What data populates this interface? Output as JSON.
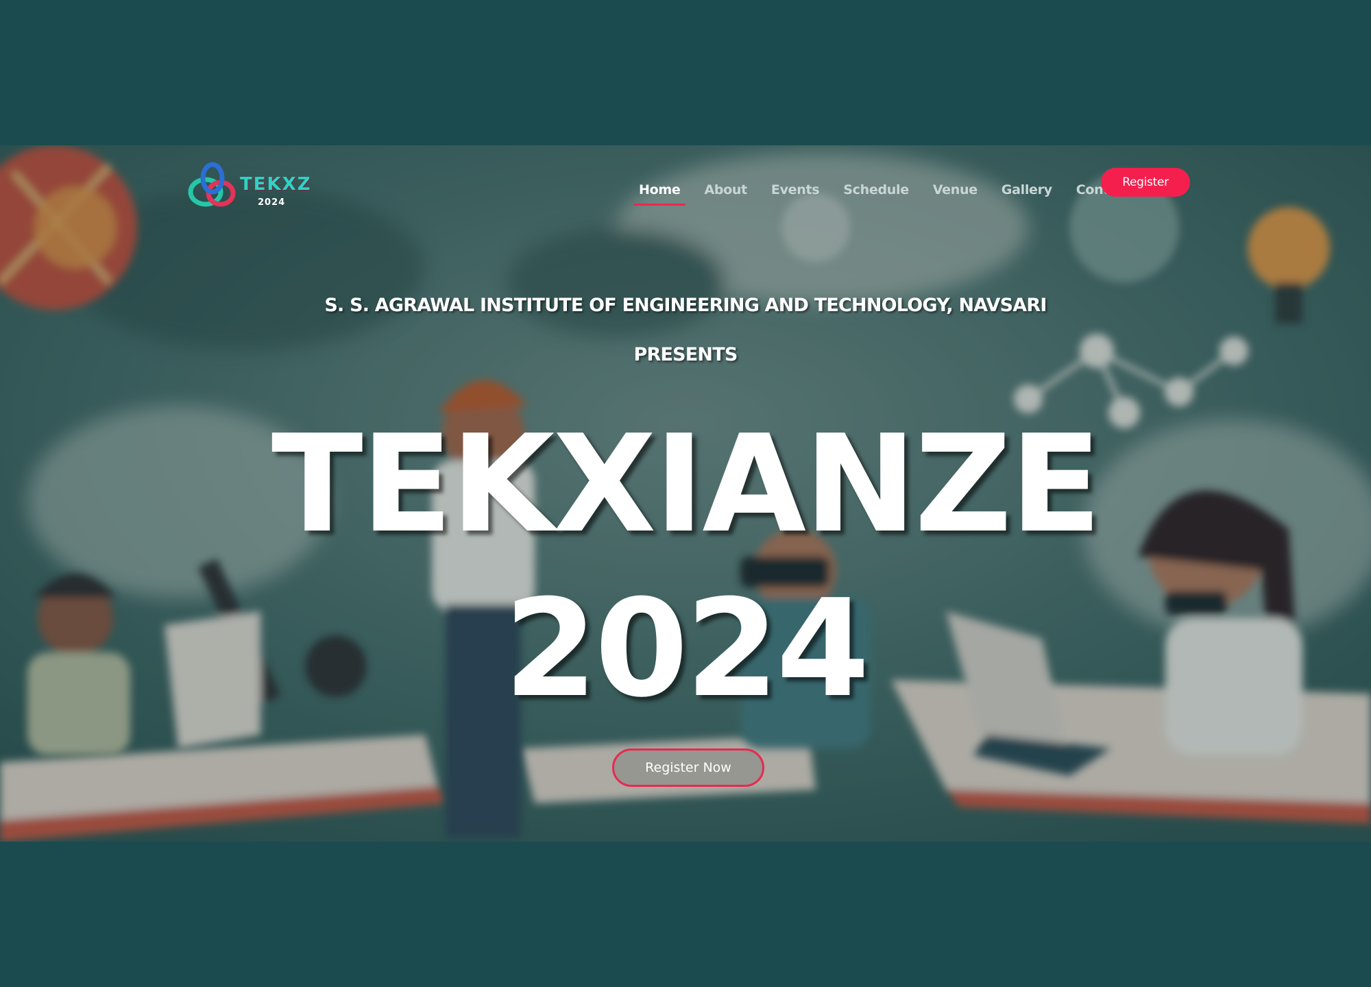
{
  "colors": {
    "page_background": "#1b4b4e",
    "accent": "#f51f4e",
    "nav_text": "#c9d6d5",
    "nav_active_text": "#ffffff"
  },
  "logo": {
    "word": "TEKXZ",
    "year": "2024",
    "icon": "interlocking-rings-logo-icon"
  },
  "nav": {
    "items": [
      {
        "label": "Home",
        "active": true
      },
      {
        "label": "About",
        "active": false
      },
      {
        "label": "Events",
        "active": false
      },
      {
        "label": "Schedule",
        "active": false
      },
      {
        "label": "Venue",
        "active": false
      },
      {
        "label": "Gallery",
        "active": false
      },
      {
        "label": "Contact",
        "active": false
      }
    ],
    "register_label": "Register"
  },
  "hero": {
    "institute": "S. S. AGRAWAL INSTITUTE OF ENGINEERING AND TECHNOLOGY, NAVSARI",
    "presents": "PRESENTS",
    "title": "TEKXIANZE",
    "year": "2024",
    "cta_label": "Register Now",
    "background_image": "illustrated-kids-tech-lab-background"
  }
}
